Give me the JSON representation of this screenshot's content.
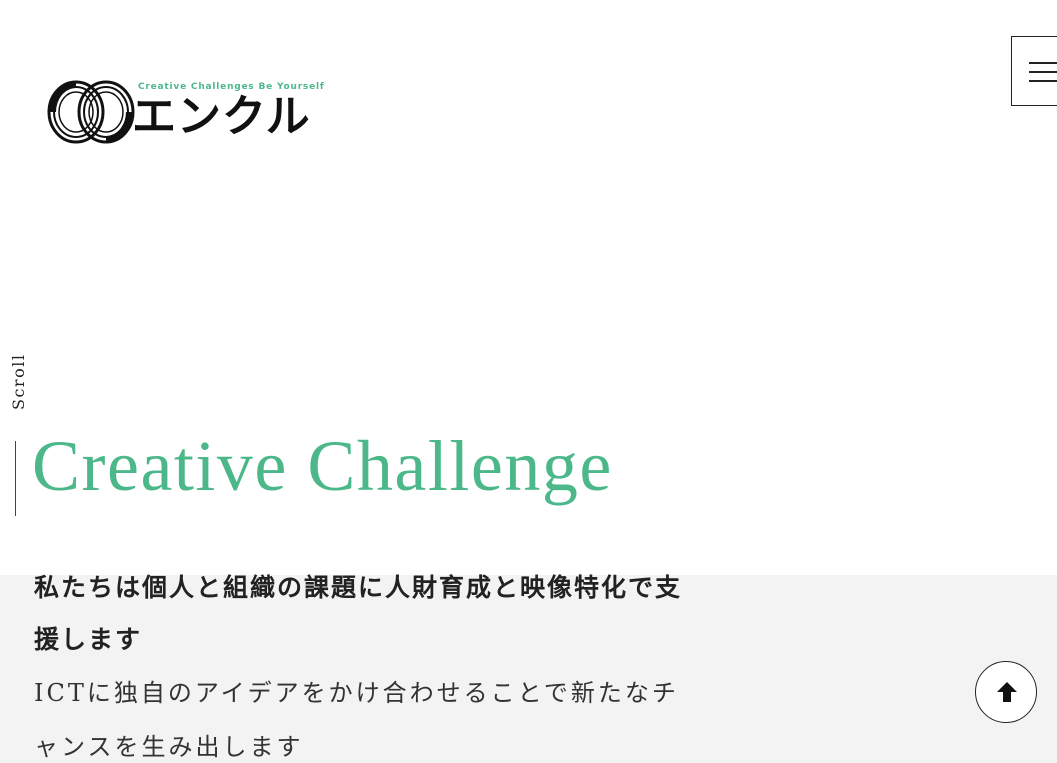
{
  "header": {
    "logo": {
      "tagline": "Creative Challenges Be Yourself",
      "name": "エンクル"
    },
    "menu_button": {
      "icon": "hamburger-menu-icon"
    }
  },
  "scroll": {
    "label": "Scroll"
  },
  "hero": {
    "heading": "Creative Challenge",
    "heading_color": "#4cb88a"
  },
  "intro": {
    "lead": "私たちは個人と組織の課題に人財育成と映像特化で支援します",
    "sub": "ICTに独自のアイデアをかけ合わせることで新たなチャンスを生み出します",
    "band_color": "#f2f3f2"
  },
  "back_to_top": {
    "icon": "arrow-up-icon"
  }
}
